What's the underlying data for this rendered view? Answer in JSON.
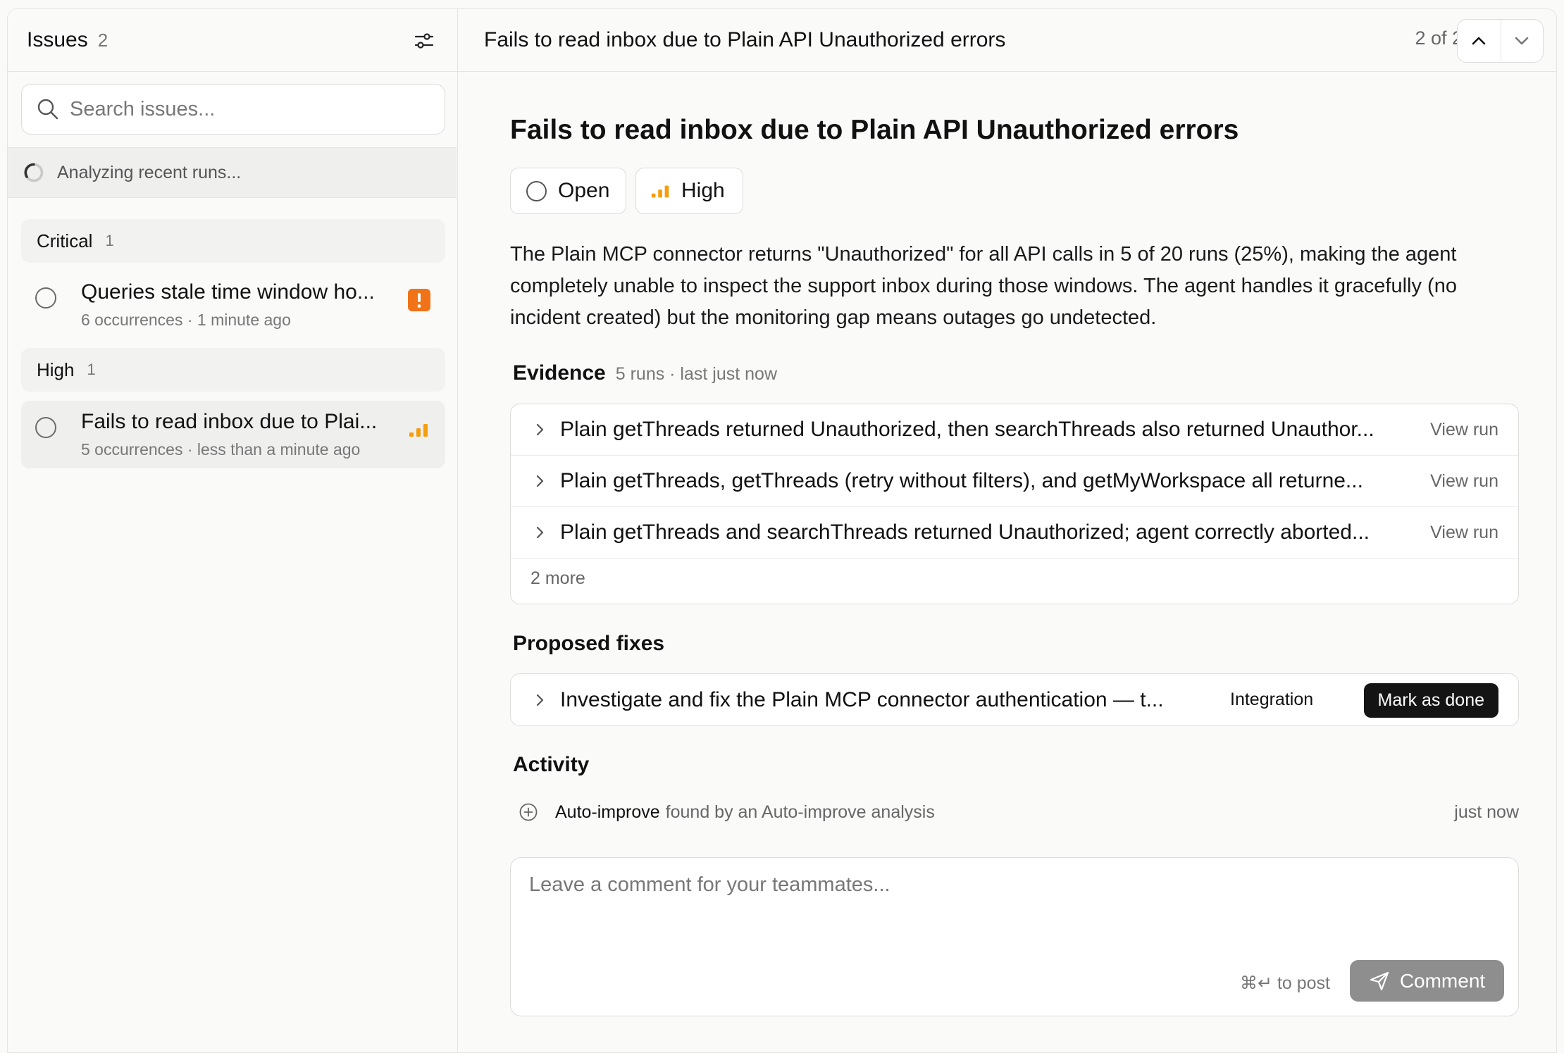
{
  "sidebar": {
    "title": "Issues",
    "count": "2",
    "search_placeholder": "Search issues...",
    "analyzing_text": "Analyzing recent runs...",
    "groups": [
      {
        "name": "Critical",
        "count": "1",
        "issues": [
          {
            "title": "Queries stale time window ho...",
            "meta": "6 occurrences · 1 minute ago",
            "priority": "critical"
          }
        ]
      },
      {
        "name": "High",
        "count": "1",
        "issues": [
          {
            "title": "Fails to read inbox due to Plai...",
            "meta": "5 occurrences · less than a minute ago",
            "priority": "high",
            "selected": true
          }
        ]
      }
    ]
  },
  "header": {
    "title": "Fails to read inbox due to Plain API Unauthorized errors",
    "pager": "2 of 2"
  },
  "issue": {
    "title": "Fails to read inbox due to Plain API Unauthorized errors",
    "status": "Open",
    "priority": "High",
    "description": "The Plain MCP connector returns \"Unauthorized\" for all API calls in 5 of 20 runs (25%), making the agent completely unable to inspect the support inbox during those windows. The agent handles it gracefully (no incident created) but the monitoring gap means outages go undetected."
  },
  "evidence": {
    "title": "Evidence",
    "subtitle": "5 runs · last just now",
    "items": [
      {
        "text": "Plain getThreads returned Unauthorized, then searchThreads also returned Unauthor...",
        "action": "View run"
      },
      {
        "text": "Plain getThreads, getThreads (retry without filters), and getMyWorkspace all returne...",
        "action": "View run"
      },
      {
        "text": "Plain getThreads and searchThreads returned Unauthorized; agent correctly aborted...",
        "action": "View run"
      }
    ],
    "more": "2 more"
  },
  "fixes": {
    "title": "Proposed fixes",
    "items": [
      {
        "text": "Investigate and fix the Plain MCP connector authentication — t...",
        "tag": "Integration",
        "action": "Mark as done"
      }
    ]
  },
  "activity": {
    "title": "Activity",
    "items": [
      {
        "actor": "Auto-improve",
        "text": "found by an Auto-improve analysis",
        "time": "just now"
      }
    ]
  },
  "comment": {
    "placeholder": "Leave a comment for your teammates...",
    "hint": "⌘↵ to post",
    "button": "Comment"
  },
  "colors": {
    "critical": "#f07317",
    "high": "#f59e0b",
    "button_dark": "#141414",
    "button_disabled": "#8e8e8e"
  },
  "icons": [
    "filter-icon",
    "search-icon",
    "spinner-icon",
    "circle-icon",
    "critical-priority-icon",
    "high-priority-icon",
    "chevron-up-icon",
    "chevron-down-icon",
    "chevron-right-icon",
    "plus-circle-icon",
    "send-icon"
  ]
}
